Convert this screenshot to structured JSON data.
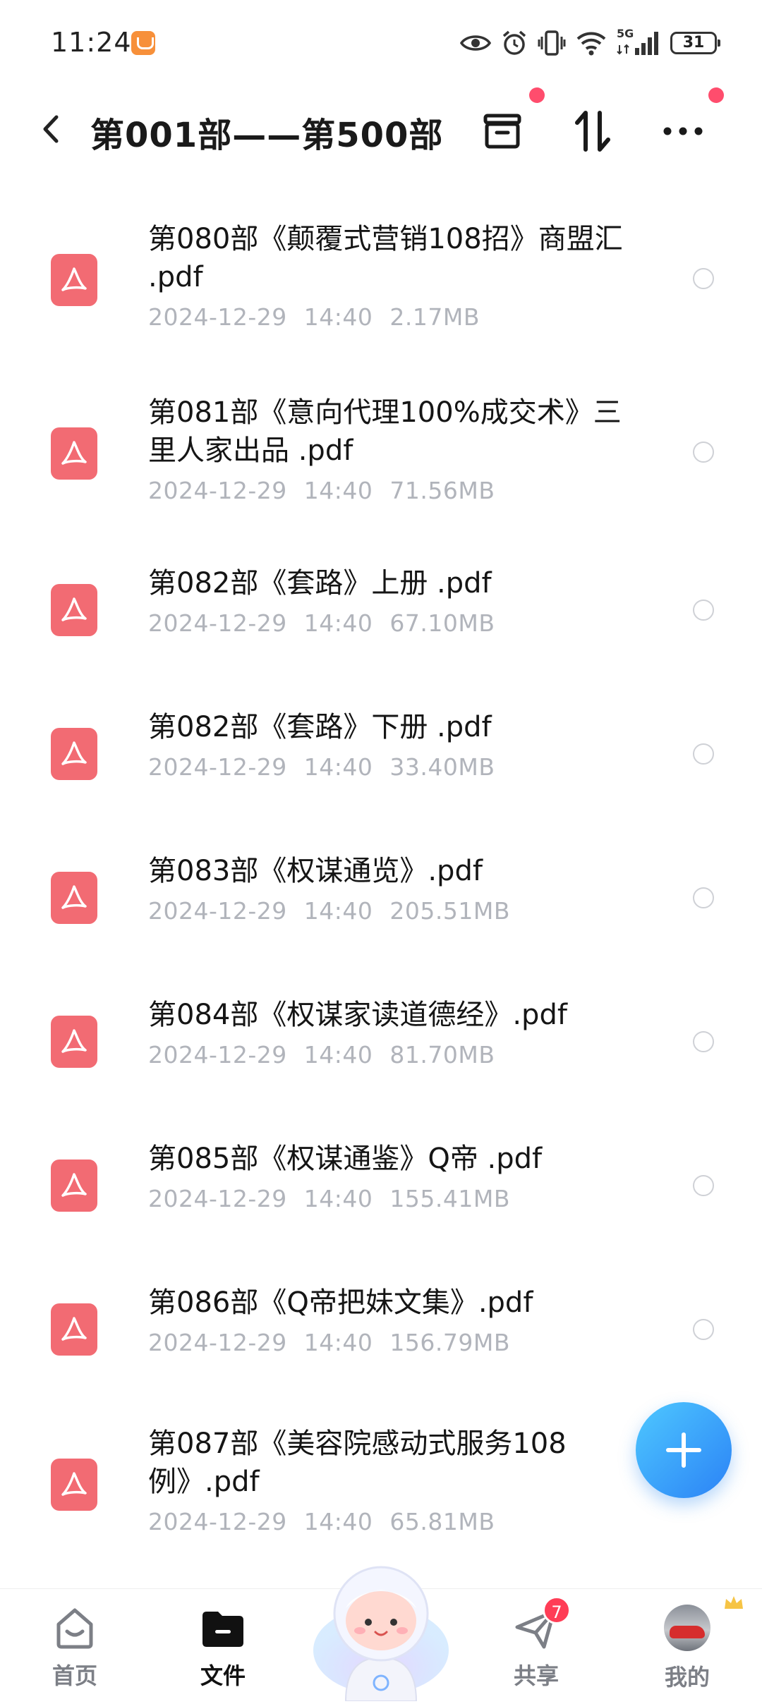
{
  "status_bar": {
    "time": "11:24",
    "battery": "31",
    "network": "5G"
  },
  "header": {
    "title": "第001部——第500部"
  },
  "files": [
    {
      "name": "第080部《颠覆式营销108招》商盟汇 .pdf",
      "date": "2024-12-29",
      "time": "14:40",
      "size": "2.17MB"
    },
    {
      "name": "第081部《意向代理100%成交术》三里人家出品 .pdf",
      "date": "2024-12-29",
      "time": "14:40",
      "size": "71.56MB"
    },
    {
      "name": "第082部《套路》上册 .pdf",
      "date": "2024-12-29",
      "time": "14:40",
      "size": "67.10MB"
    },
    {
      "name": "第082部《套路》下册 .pdf",
      "date": "2024-12-29",
      "time": "14:40",
      "size": "33.40MB"
    },
    {
      "name": "第083部《权谋通览》.pdf",
      "date": "2024-12-29",
      "time": "14:40",
      "size": "205.51MB"
    },
    {
      "name": "第084部《权谋家读道德经》.pdf",
      "date": "2024-12-29",
      "time": "14:40",
      "size": "81.70MB"
    },
    {
      "name": "第085部《权谋通鉴》Q帝 .pdf",
      "date": "2024-12-29",
      "time": "14:40",
      "size": "155.41MB"
    },
    {
      "name": "第086部《Q帝把妹文集》.pdf",
      "date": "2024-12-29",
      "time": "14:40",
      "size": "156.79MB"
    },
    {
      "name": "第087部《美容院感动式服务108例》.pdf",
      "date": "2024-12-29",
      "time": "14:40",
      "size": "65.81MB"
    }
  ],
  "nav": {
    "home": "首页",
    "files": "文件",
    "share": "共享",
    "share_badge": "7",
    "mine": "我的"
  },
  "colors": {
    "accent": "#2b82f6",
    "pdf": "#f26b73",
    "badge": "#ff3d56"
  }
}
